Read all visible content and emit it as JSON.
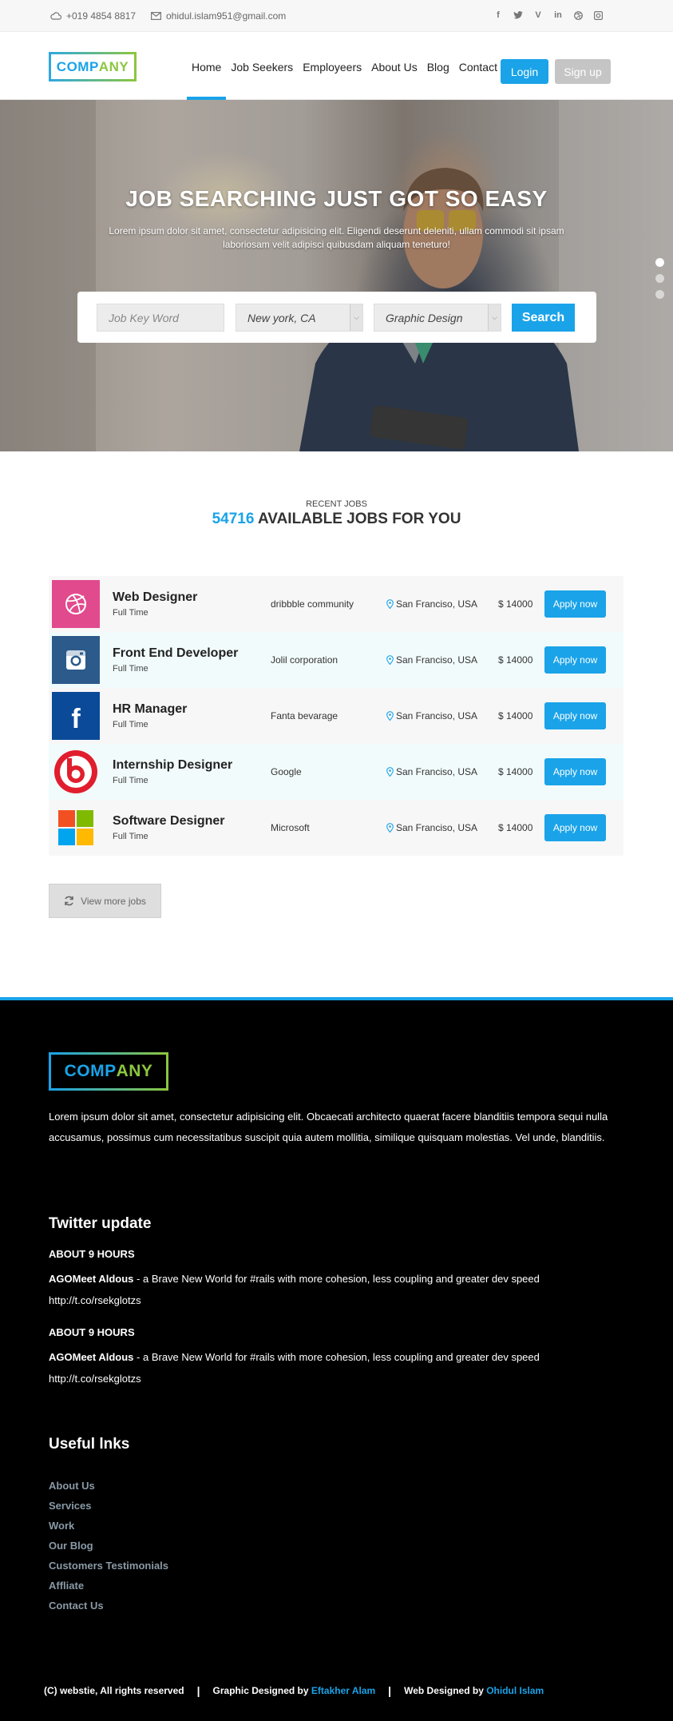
{
  "topbar": {
    "phone": "+019 4854 8817",
    "email": "ohidul.islam951@gmail.com",
    "social": [
      "facebook-icon",
      "twitter-icon",
      "vine-icon",
      "linkedin-icon",
      "dribbble-icon",
      "instagram-icon"
    ]
  },
  "brand": {
    "logo_part1": "COMP",
    "logo_part2": "ANY"
  },
  "nav": {
    "items": [
      "Home",
      "Job Seekers",
      "Employeers",
      "About Us",
      "Blog",
      "Contact"
    ],
    "active": "Home",
    "login": "Login",
    "signup": "Sign up"
  },
  "hero": {
    "title": "JOB SEARCHING JUST GOT SO EASY",
    "subtitle": "Lorem ipsum dolor sit amet, consectetur adipisicing elit. Eligendi deserunt deleniti, ullam commodi sit ipsam laboriosam velit adipisci quibusdam aliquam teneturo!",
    "search": {
      "keyword_placeholder": "Job Key Word",
      "location": "New york, CA",
      "category": "Graphic Design",
      "button": "Search"
    },
    "slides": 3,
    "active_slide": 1
  },
  "recent_jobs": {
    "kicker": "RECENT JOBS",
    "count": "54716",
    "title_rest": "AVAILABLE JOBS FOR YOU",
    "apply_label": "Apply now",
    "jobs": [
      {
        "title": "Web Designer",
        "type": "Full Time",
        "company": "dribbble community",
        "location": "San Franciso, USA",
        "salary": "$ 14000",
        "icon": "dribbble-logo-icon"
      },
      {
        "title": "Front End Developer",
        "type": "Full Time",
        "company": "Jolil corporation",
        "location": "San Franciso, USA",
        "salary": "$ 14000",
        "icon": "instagram-logo-icon"
      },
      {
        "title": "HR Manager",
        "type": "Full Time",
        "company": "Fanta bevarage",
        "location": "San Franciso, USA",
        "salary": "$ 14000",
        "icon": "facebook-logo-icon"
      },
      {
        "title": "Internship Designer",
        "type": "Full Time",
        "company": "Google",
        "location": "San Franciso, USA",
        "salary": "$ 14000",
        "icon": "beats-logo-icon"
      },
      {
        "title": "Software Designer",
        "type": "Full Time",
        "company": "Microsoft",
        "location": "San Franciso, USA",
        "salary": "$ 14000",
        "icon": "microsoft-logo-icon"
      }
    ],
    "view_more": "View more jobs"
  },
  "footer": {
    "logo_part1": "COMP",
    "logo_part2": "ANY",
    "description": "Lorem ipsum dolor sit amet, consectetur adipisicing elit. Obcaecati architecto quaerat facere blanditiis tempora sequi nulla accusamus, possimus cum necessitatibus suscipit quia autem mollitia, similique quisquam molestias. Vel unde, blanditiis.",
    "twitter_heading": "Twitter update",
    "tweets": [
      {
        "time": "ABOUT 9 HOURS",
        "user": "AGOMeet Aldous",
        "text": " - a Brave New World for #rails with more cohesion, less coupling and greater dev speed http://t.co/rsekglotzs"
      },
      {
        "time": "ABOUT 9 HOURS",
        "user": "AGOMeet Aldous",
        "text": " - a Brave New World for #rails with more cohesion, less coupling and greater dev speed http://t.co/rsekglotzs"
      }
    ],
    "links_heading": "Useful lnks",
    "links": [
      "About Us",
      "Services",
      "Work",
      "Our Blog",
      "Customers Testimonials",
      "Affliate",
      "Contact Us"
    ],
    "copyright": "(C) webstie, All rights reserved",
    "graphic_prefix": "Graphic Designed by",
    "graphic_name": "Eftakher Alam",
    "web_prefix": "Web Designed by",
    "web_name": "Ohidul Islam"
  },
  "colors": {
    "accent": "#1aa3e8",
    "green": "#8cc63f",
    "footer_bg": "#000000"
  }
}
